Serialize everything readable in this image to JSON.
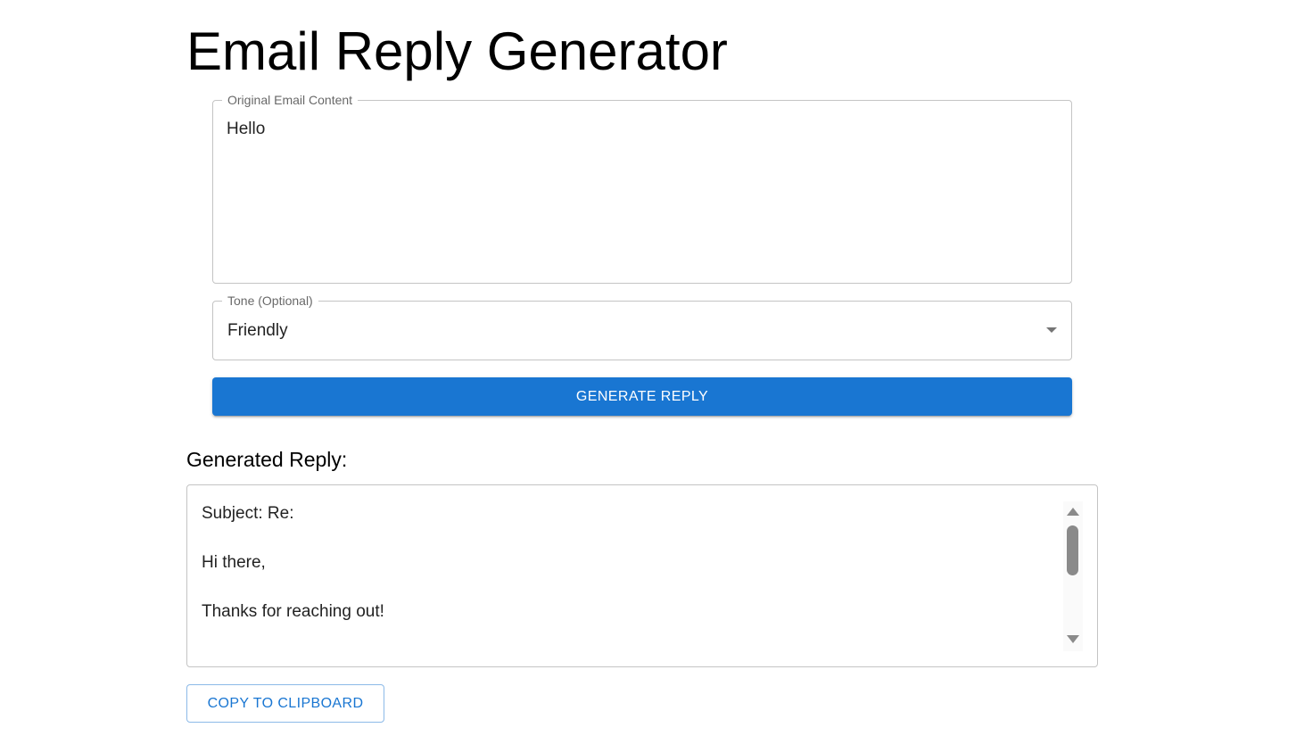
{
  "page": {
    "title": "Email Reply Generator"
  },
  "email_field": {
    "label": "Original Email Content",
    "value": "Hello"
  },
  "tone_field": {
    "label": "Tone (Optional)",
    "selected": "Friendly",
    "icon": "arrow-drop-down-icon"
  },
  "generate_button": {
    "label": "GENERATE REPLY"
  },
  "reply": {
    "heading": "Generated Reply:",
    "lines": [
      "Subject: Re:",
      "Hi there,",
      "Thanks for reaching out!"
    ]
  },
  "copy_button": {
    "label": "COPY TO CLIPBOARD"
  },
  "colors": {
    "primary": "#1976d2",
    "border": "#c4c4c4",
    "scrollbar": "#8a8a8a"
  }
}
